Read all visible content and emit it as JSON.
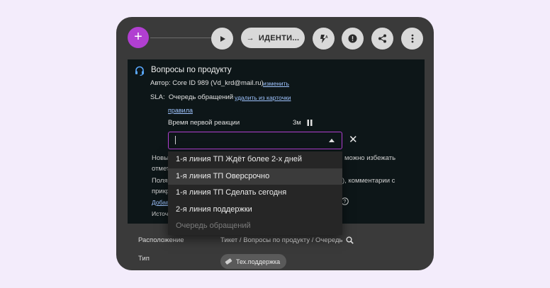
{
  "toolbar": {
    "add_label": "+",
    "pill_arrow": "→",
    "pill_label": "ИДЕНТИ..."
  },
  "ticket": {
    "title": "Вопросы по продукту",
    "author_label": "Автор:",
    "author_value": "Core ID 989 (Vd_krd@mail.ru)",
    "author_change_link": "изменить",
    "sla_label": "SLA:",
    "sla_value": "Очередь обращений",
    "sla_remove_link": "удалить из карточки",
    "rules_link": "правила",
    "first_response_label": "Время первой реакции",
    "first_response_value": "3м",
    "text_new_left": "Новы",
    "text_new_right": "можно избежать",
    "text_otmet": "отмет",
    "text_fields_left": "Поля",
    "text_fields_right": "), комментарии с",
    "text_prikr": "прикр",
    "text_add": "Добав",
    "text_source": "Источ"
  },
  "select": {
    "value": "",
    "clear_symbol": "✕",
    "options": [
      {
        "label": "1-я линия ТП Ждёт более 2-х дней",
        "state": "normal"
      },
      {
        "label": "1-я линия ТП Овер­срочно",
        "state": "hover"
      },
      {
        "label": "1-я линия ТП Сделать сегодня",
        "state": "normal"
      },
      {
        "label": "2-я линия поддержки",
        "state": "normal"
      },
      {
        "label": "Очередь обращений",
        "state": "disabled"
      }
    ]
  },
  "details": {
    "location_label": "Расположение",
    "location_value": "Тикет / Вопросы по продукту / Очередь",
    "type_label": "Тип",
    "type_chip": "Тех.поддержка"
  },
  "colors": {
    "accent": "#b13fd1",
    "panel": "#0d1618",
    "window": "#3a3a3a",
    "link": "#9fc4ff"
  }
}
